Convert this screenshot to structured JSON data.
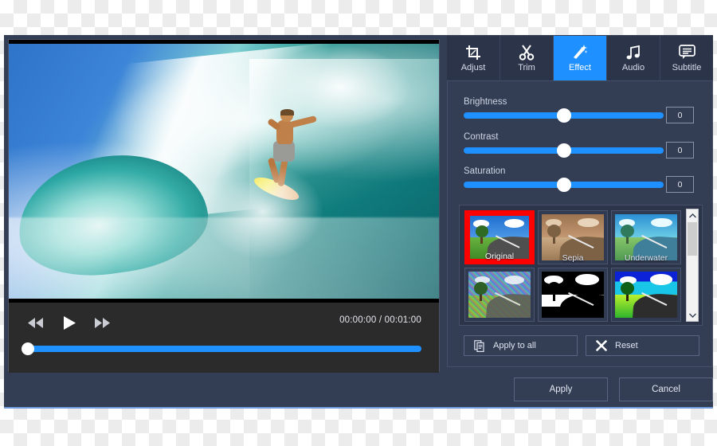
{
  "window": {
    "accent_color": "#1e90ff",
    "panel_color": "#333e54",
    "selected_effect_color": "#ff0000"
  },
  "preview": {
    "scene": "surfer riding a large ocean wave",
    "transport": {
      "rewind_label": "rewind-icon",
      "play_label": "play-icon",
      "forward_label": "fast-forward-icon"
    },
    "time": {
      "current": "00:00:00",
      "separator": "/",
      "total": "00:01:00",
      "display": "00:00:00  /  00:01:00"
    },
    "seek_percent": 0
  },
  "tabs": [
    {
      "label": "Adjust",
      "icon": "crop-icon",
      "active": false
    },
    {
      "label": "Trim",
      "icon": "scissors-icon",
      "active": false
    },
    {
      "label": "Effect",
      "icon": "magic-wand-icon",
      "active": true
    },
    {
      "label": "Audio",
      "icon": "music-note-icon",
      "active": false
    },
    {
      "label": "Subtitle",
      "icon": "speech-bubble-icon",
      "active": false
    }
  ],
  "sliders": [
    {
      "label": "Brightness",
      "value": "0",
      "percent": 50
    },
    {
      "label": "Contrast",
      "value": "0",
      "percent": 50
    },
    {
      "label": "Saturation",
      "value": "0",
      "percent": 50
    }
  ],
  "effects": [
    {
      "label": "Original",
      "selected": true,
      "style": "original"
    },
    {
      "label": "Sepia",
      "selected": false,
      "style": "sepia"
    },
    {
      "label": "Underwater",
      "selected": false,
      "style": "underwater"
    },
    {
      "label": "",
      "selected": false,
      "style": "noise"
    },
    {
      "label": "",
      "selected": false,
      "style": "blackwhite"
    },
    {
      "label": "",
      "selected": false,
      "style": "vivid"
    }
  ],
  "scrollbar": {
    "up_arrow": "chevron-up-icon",
    "down_arrow": "chevron-down-icon"
  },
  "actions": {
    "apply_to_all": {
      "label": "Apply to all",
      "icon": "copy-icon"
    },
    "reset": {
      "label": "Reset",
      "icon": "close-x-icon"
    }
  },
  "footer": {
    "apply": "Apply",
    "cancel": "Cancel"
  }
}
